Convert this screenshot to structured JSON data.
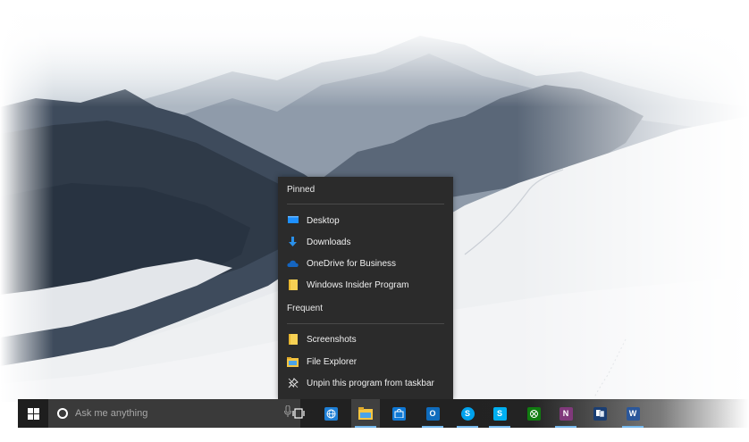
{
  "jumplist": {
    "pinned_header": "Pinned",
    "pinned": [
      {
        "label": "Desktop",
        "icon": "desktop-icon"
      },
      {
        "label": "Downloads",
        "icon": "downloads-icon"
      },
      {
        "label": "OneDrive for Business",
        "icon": "onedrive-icon"
      },
      {
        "label": "Windows Insider Program",
        "icon": "folder-icon"
      }
    ],
    "frequent_header": "Frequent",
    "frequent": [
      {
        "label": "Screenshots",
        "icon": "folder-icon"
      },
      {
        "label": "File Explorer",
        "icon": "file-explorer-icon"
      }
    ],
    "unpin_label": "Unpin this program from taskbar"
  },
  "taskbar": {
    "search_placeholder": "Ask me anything",
    "apps": [
      {
        "name": "Task View",
        "icon": "task-view-icon"
      },
      {
        "name": "Internet Explorer",
        "icon": "edge-icon",
        "color": "#1e7fd6"
      },
      {
        "name": "File Explorer",
        "icon": "file-explorer-icon",
        "color": "#f5c542"
      },
      {
        "name": "Store",
        "icon": "store-icon",
        "color": "#0f78d4"
      },
      {
        "name": "Outlook",
        "icon": "outlook-icon",
        "color": "#0f6cbd"
      },
      {
        "name": "Skype for Business",
        "icon": "skype-business-icon",
        "color": "#00a2ed"
      },
      {
        "name": "Skype",
        "icon": "skype-icon",
        "color": "#00aff0"
      },
      {
        "name": "Xbox",
        "icon": "xbox-icon",
        "color": "#107c10"
      },
      {
        "name": "OneNote",
        "icon": "onenote-icon",
        "color": "#80397b"
      },
      {
        "name": "Solitaire",
        "icon": "solitaire-icon",
        "color": "#1a3e73"
      },
      {
        "name": "Word",
        "icon": "word-icon",
        "color": "#2b579a"
      }
    ]
  },
  "colors": {
    "menu_bg": "#2b2b2b",
    "taskbar_bg": "#1e1e1e",
    "search_bg": "#3a3a3a",
    "accent": "#76b9ed"
  }
}
